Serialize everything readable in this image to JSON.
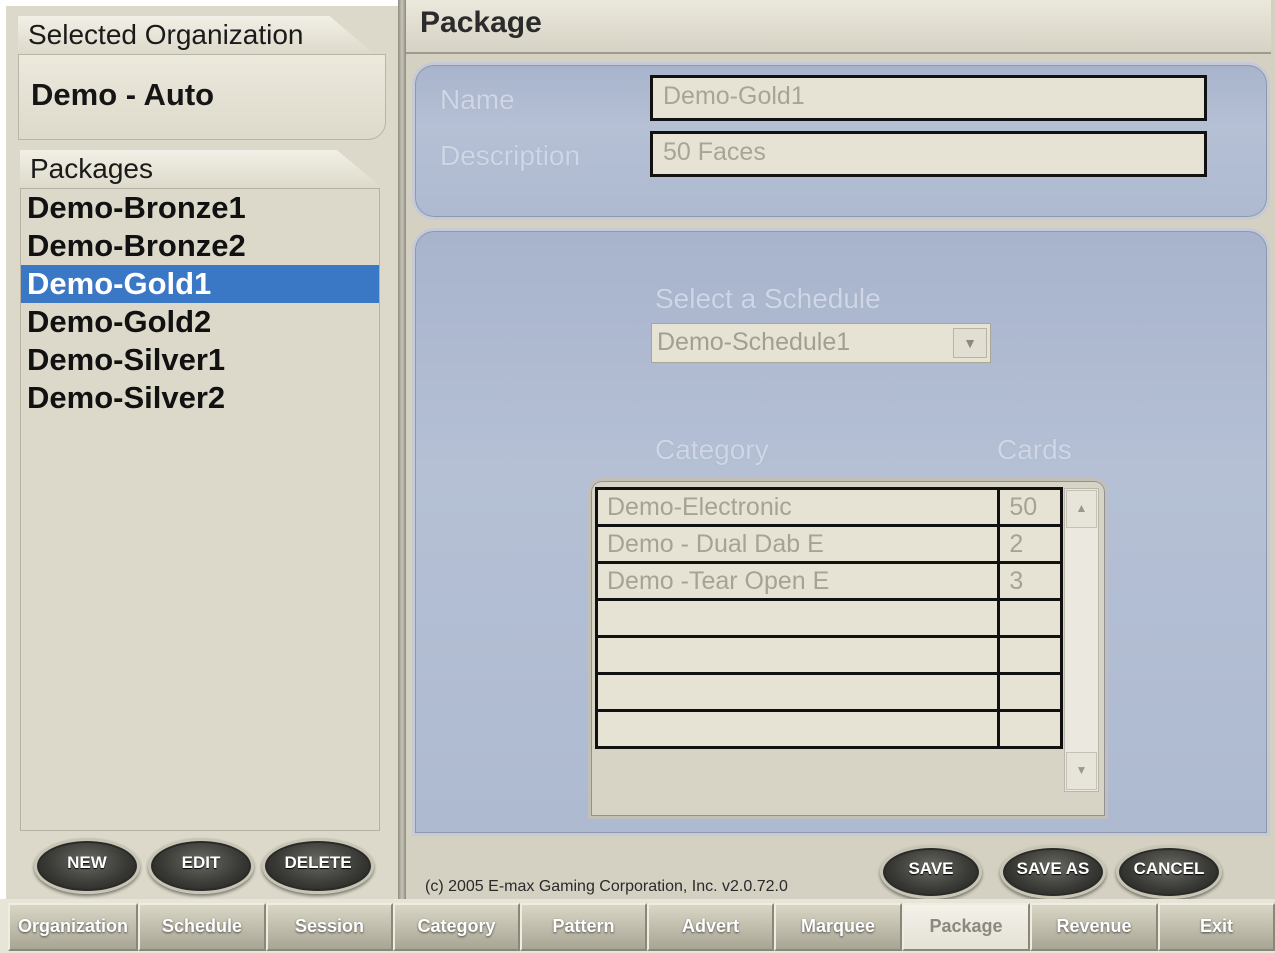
{
  "sidebar": {
    "selected_org_label": "Selected Organization",
    "org_name": "Demo - Auto",
    "packages_label": "Packages",
    "packages": [
      "Demo-Bronze1",
      "Demo-Bronze2",
      "Demo-Gold1",
      "Demo-Gold2",
      "Demo-Silver1",
      "Demo-Silver2"
    ],
    "selected_package": "Demo-Gold1",
    "buttons": {
      "new": "NEW",
      "edit": "EDIT",
      "delete": "DELETE"
    }
  },
  "main": {
    "title": "Package",
    "name_label": "Name",
    "name_value": "Demo-Gold1",
    "description_label": "Description",
    "description_value": "50 Faces",
    "schedule_label": "Select a Schedule",
    "schedule_value": "Demo-Schedule1",
    "grid": {
      "col_category": "Category",
      "col_cards": "Cards",
      "rows": [
        {
          "category": "Demo-Electronic",
          "cards": "50"
        },
        {
          "category": "Demo - Dual Dab E",
          "cards": "2"
        },
        {
          "category": "Demo -Tear Open E",
          "cards": "3"
        },
        {
          "category": "",
          "cards": ""
        },
        {
          "category": "",
          "cards": ""
        },
        {
          "category": "",
          "cards": ""
        },
        {
          "category": "",
          "cards": ""
        }
      ]
    },
    "actions": {
      "save": "SAVE",
      "save_as": "SAVE AS",
      "cancel": "CANCEL"
    },
    "copyright": "(c) 2005 E-max Gaming Corporation, Inc. v2.0.72.0"
  },
  "nav": {
    "tabs": [
      "Organization",
      "Schedule",
      "Session",
      "Category",
      "Pattern",
      "Advert",
      "Marquee",
      "Package",
      "Revenue",
      "Exit"
    ],
    "active": "Package"
  },
  "colors": {
    "selection": "#3a78c5",
    "panel_blue": "#b5c0d5",
    "sidebar_beige": "#dcd9ca"
  }
}
